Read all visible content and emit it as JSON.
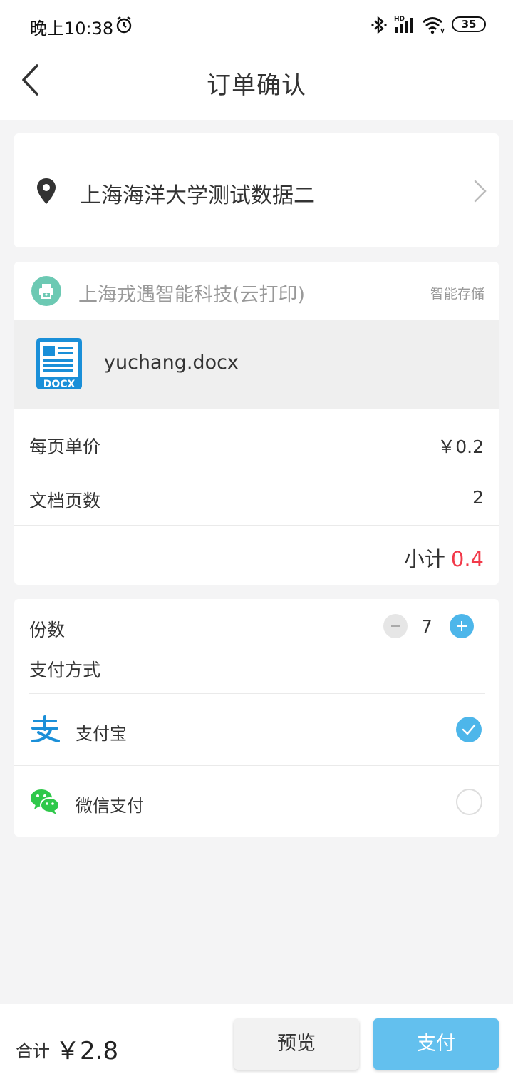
{
  "status_bar": {
    "time": "晚上10:38",
    "battery": "35",
    "icons": [
      "alarm-icon",
      "bluetooth-icon",
      "signal-hd-icon",
      "wifi-icon",
      "battery-icon"
    ]
  },
  "header": {
    "title": "订单确认",
    "back_icon": "chevron-left-icon"
  },
  "address": {
    "icon": "location-pin-icon",
    "text": "上海海洋大学测试数据二",
    "chevron_icon": "chevron-right-icon"
  },
  "order": {
    "shop_icon": "printer-icon",
    "shop_name": "上海戎遇智能科技(云打印)",
    "shop_tag": "智能存储",
    "file_icon": "docx-file-icon",
    "file_badge": "DOCX",
    "file_name": "yuchang.docx",
    "unit_price_label": "每页单价",
    "unit_price_value": "￥0.2",
    "pages_label": "文档页数",
    "pages_value": "2",
    "subtotal_label": "小计",
    "subtotal_value": "0.4"
  },
  "payment": {
    "copies_label": "份数",
    "copies_value": "7",
    "method_label": "支付方式",
    "options": [
      {
        "label": "支付宝",
        "icon": "alipay-icon",
        "selected": true
      },
      {
        "label": "微信支付",
        "icon": "wechat-pay-icon",
        "selected": false
      }
    ]
  },
  "footer": {
    "total_label": "合计",
    "total_value": "￥2.8",
    "preview_label": "预览",
    "pay_label": "支付"
  },
  "colors": {
    "accent": "#4db6ea",
    "pay_button": "#63c0ee",
    "subtotal": "#f23a4a",
    "shop_avatar": "#6cc9b3",
    "wechat_green": "#2fc84a",
    "docx_blue": "#1a8fd8",
    "background": "#f4f4f5"
  }
}
